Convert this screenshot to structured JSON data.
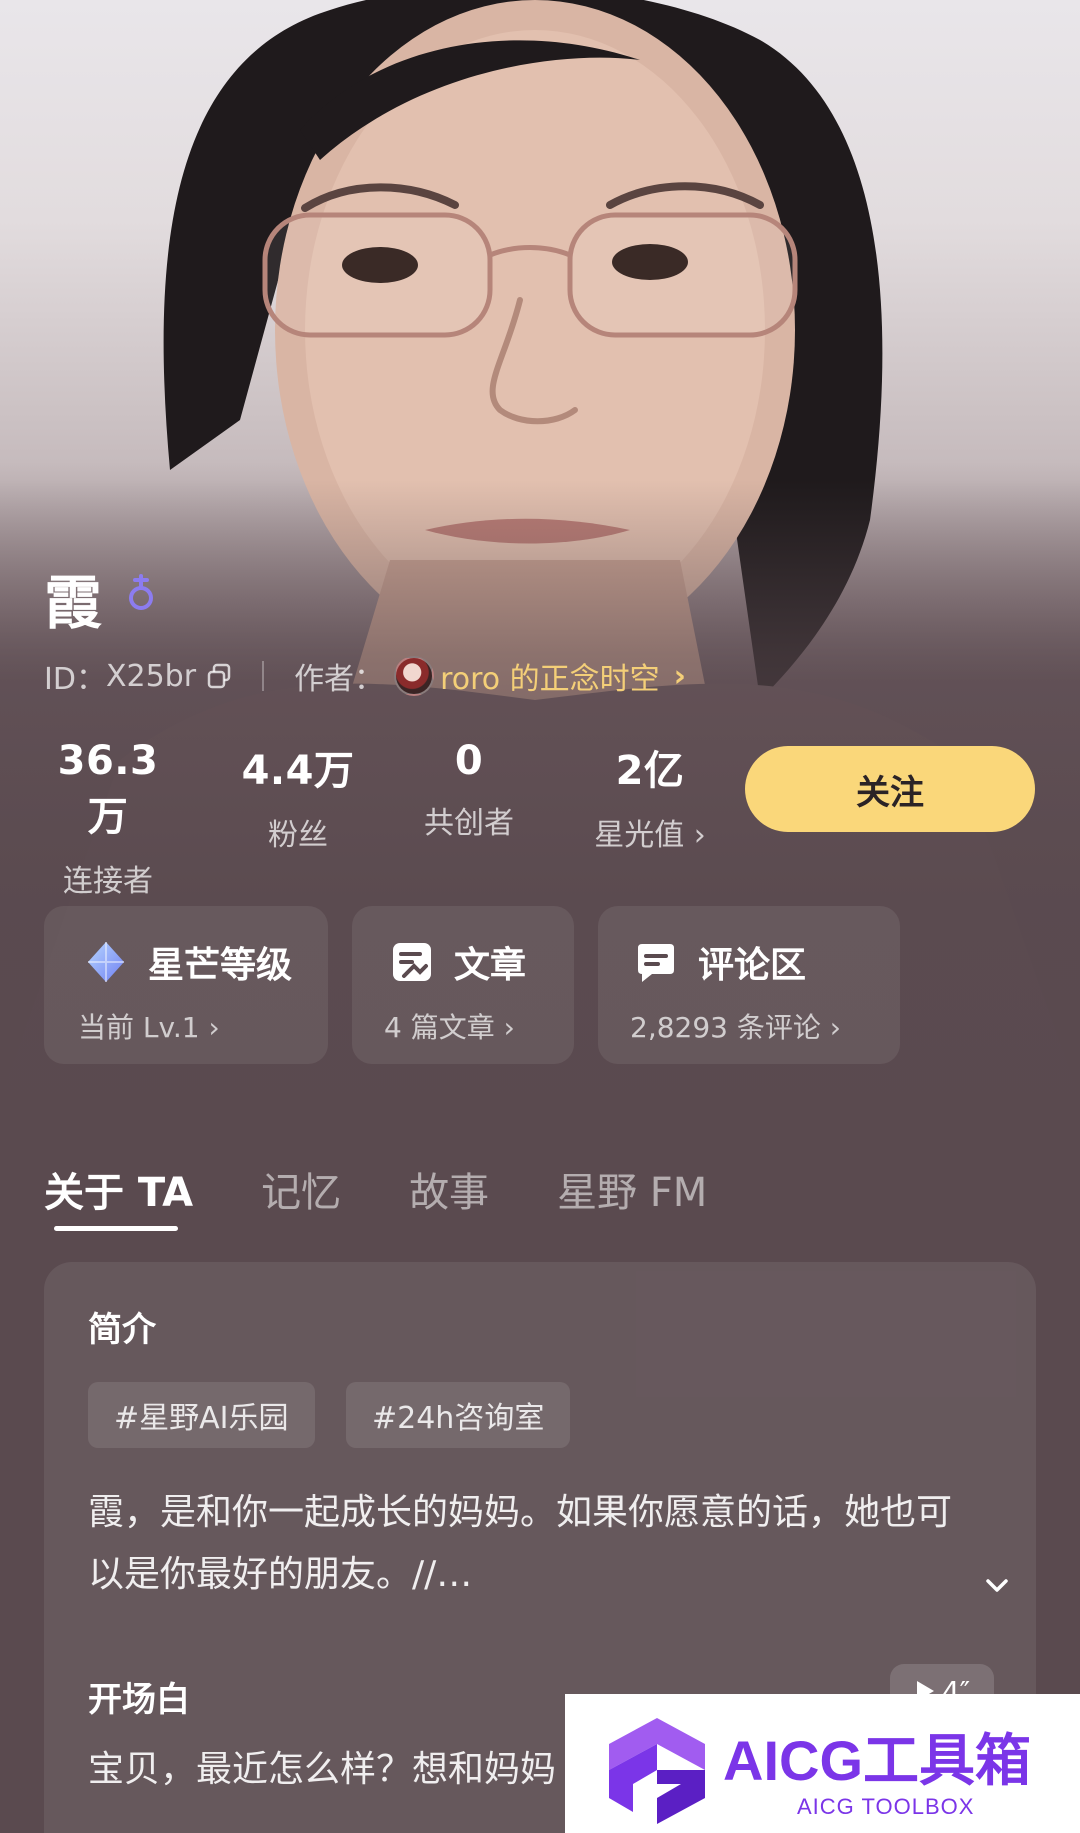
{
  "profile": {
    "name": "霞",
    "gender_symbol": "⚲",
    "id_label": "ID：",
    "id_value": "X25br",
    "author_label": "作者：",
    "author_name": "roro 的正念时空",
    "author_chevron": "›"
  },
  "stats": [
    {
      "value": "36.3万",
      "label": "连接者"
    },
    {
      "value": "4.4万",
      "label": "粉丝"
    },
    {
      "value": "0",
      "label": "共创者"
    },
    {
      "value": "2亿",
      "label": "星光值 ›"
    }
  ],
  "follow_label": "关注",
  "cards": [
    {
      "title": "星芒等级",
      "sub": "当前 Lv.1 ›",
      "icon": "diamond-icon"
    },
    {
      "title": "文章",
      "sub": "4 篇文章 ›",
      "icon": "article-icon"
    },
    {
      "title": "评论区",
      "sub": "2,8293 条评论 ›",
      "icon": "comment-icon"
    }
  ],
  "tabs": [
    "关于 TA",
    "记忆",
    "故事",
    "星野 FM"
  ],
  "intro": {
    "heading": "简介",
    "tags": [
      "#星野AI乐园",
      "#24h咨询室"
    ],
    "text": "霞，是和你一起成长的妈妈。如果你愿意的话，她也可以是你最好的朋友。//…"
  },
  "opening": {
    "heading": "开场白",
    "voice_duration": "4″",
    "text": "宝贝，最近怎么样？想和妈妈"
  },
  "watermark": {
    "title": "AICG工具箱",
    "subtitle": "AICG TOOLBOX"
  },
  "colors": {
    "accent_gold": "#f4cf78",
    "follow_bg": "#fad77a",
    "background": "#5a4a4f",
    "watermark_purple": "#7b35e8"
  }
}
